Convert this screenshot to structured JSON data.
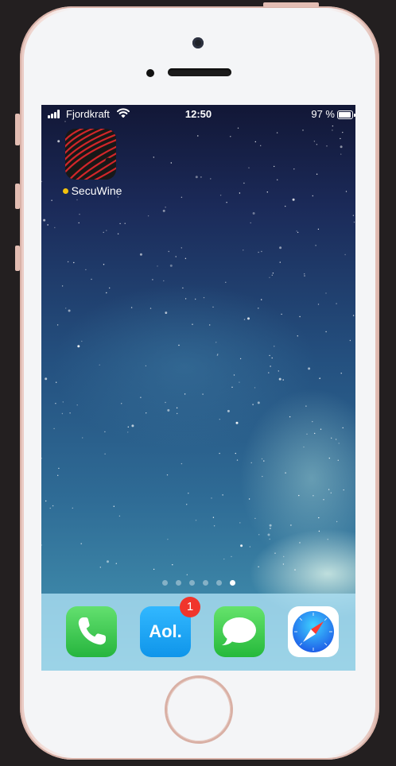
{
  "status_bar": {
    "carrier": "Fjordkraft",
    "time": "12:50",
    "battery_percent": "97 %",
    "battery_level": 0.97,
    "icons": [
      "signal-icon",
      "wifi-icon",
      "battery-icon"
    ]
  },
  "home_screen": {
    "apps": [
      {
        "label": "SecuWine",
        "icon": "secuwine-app-icon",
        "notification_dot_color": "#f4c20d"
      }
    ],
    "page_indicator": {
      "pages": 6,
      "current_page": 6
    }
  },
  "dock": {
    "apps": [
      {
        "icon": "phone-app-icon",
        "color": "#34c759"
      },
      {
        "icon": "aol-app-icon",
        "text": "Aol.",
        "badge": "1",
        "color": "#1aa3f5"
      },
      {
        "icon": "messages-app-icon",
        "color": "#35c94e"
      },
      {
        "icon": "safari-app-icon",
        "color": "#1e7cf0"
      }
    ]
  },
  "colors": {
    "phone_body": "#f4f5f7",
    "phone_trim": "#e3bdb3",
    "badge": "#f0352c"
  }
}
